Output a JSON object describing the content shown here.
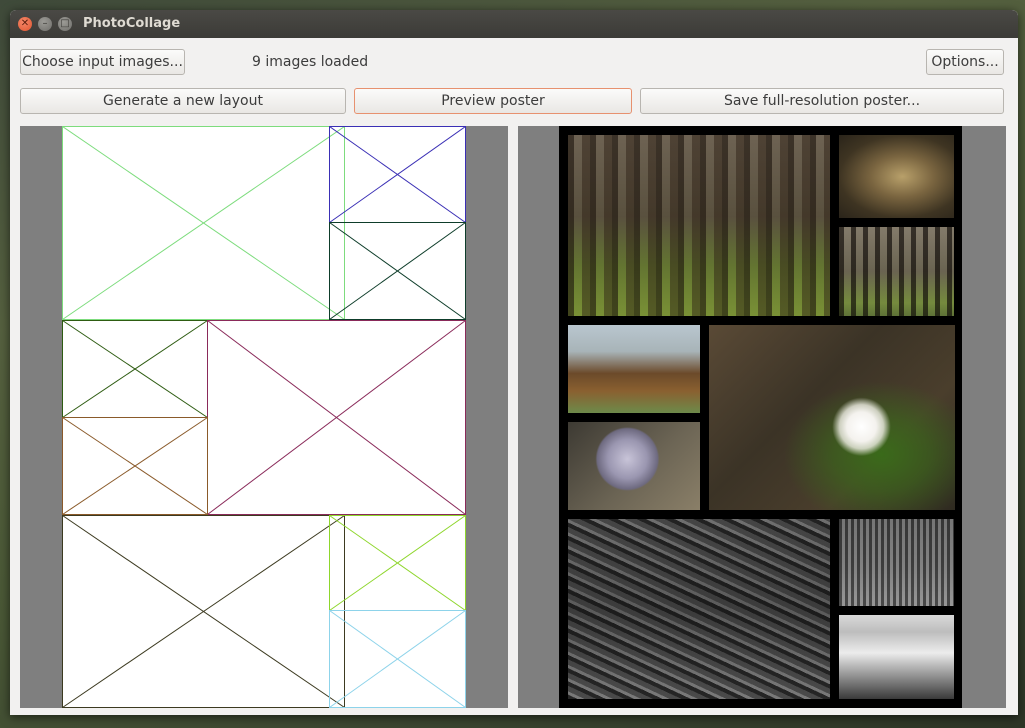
{
  "window": {
    "title": "PhotoCollage"
  },
  "toolbar": {
    "choose_label": "Choose input images...",
    "status": "9 images loaded",
    "options_label": "Options...",
    "generate_label": "Generate a new layout",
    "preview_label": "Preview poster",
    "save_label": "Save full-resolution poster..."
  },
  "layout_preview": {
    "cells": [
      {
        "color": "#7ddc7d"
      },
      {
        "color": "#3a2fb5"
      },
      {
        "color": "#0e3d2a"
      },
      {
        "color": "#2e5c12"
      },
      {
        "color": "#8a2a5a"
      },
      {
        "color": "#8a5a2a"
      },
      {
        "color": "#3c3a20"
      },
      {
        "color": "#8ed62c"
      },
      {
        "color": "#8dd3ea"
      }
    ]
  },
  "poster_preview": {
    "photos": [
      "forest-photo",
      "owl-photo",
      "forest-path-photo",
      "church-photo",
      "snail-photo",
      "anemone-photo",
      "roots-photo",
      "orchard-photo",
      "snow-field-photo"
    ]
  }
}
